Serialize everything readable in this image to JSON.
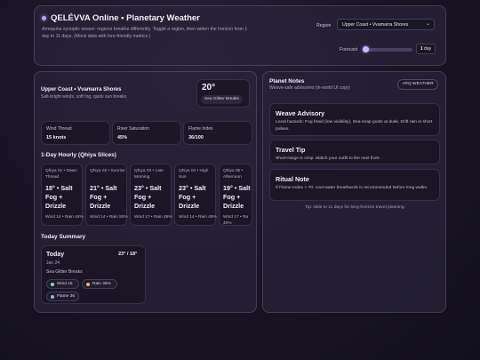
{
  "header": {
    "title": "QELÉVVA Online • Planetary Weather",
    "subtitle": "Arrequina synoptic weave: regions breathe differently. Toggle a region, then widen the horizon from 1 day to 11 days. (Mock data with lore-friendly metrics.)",
    "region_label": "Region",
    "region_value": "Upper Coast • Vvamarra Shores",
    "forecast_label": "Forecast",
    "forecast_days": "1",
    "forecast_unit": "day",
    "forecast_slider_fraction": 0.0
  },
  "location": {
    "name": "Upper Coast • Vvamarra Shores",
    "desc": "Salt-bright winds, soft fog, quick sun breaks",
    "temp": "20°",
    "condition": "Sea Glitter Breaks"
  },
  "metrics": [
    {
      "label": "Wind Thread",
      "value": "15 knots"
    },
    {
      "label": "River Saturation",
      "value": "45%"
    },
    {
      "label": "Flame Index",
      "value": "36/100"
    }
  ],
  "hourly": {
    "title": "1-Day Hourly (Qhiya Slices)",
    "slices": [
      {
        "head": "Qhiya 01 • Dawn Thread",
        "temp": "18° • Salt Fog + Drizzle",
        "meta": "Wind 14 • Rain 44%"
      },
      {
        "head": "Qhiya 02 • Sunrise",
        "temp": "21° • Salt Fog + Drizzle",
        "meta": "Wind 14 • Rain 50%"
      },
      {
        "head": "Qhiya 03 • Late Morning",
        "temp": "23° • Salt Fog + Drizzle",
        "meta": "Wind 17 • Rain 45%"
      },
      {
        "head": "Qhiya 04 • High Sun",
        "temp": "23° • Salt Fog + Drizzle",
        "meta": "Wind 14 • Rain 49%"
      },
      {
        "head": "Qhiya 05 • Afternoon",
        "temp": "19° • Salt Fog + Drizzle",
        "meta": "Wind 17 • Ra 40%"
      }
    ]
  },
  "summary": {
    "title": "Today Summary",
    "day": "Today",
    "date": "Jan 24",
    "hilo": "23° / 18°",
    "condition": "Sea Glitter Breaks",
    "chips": [
      {
        "label": "Wind 15",
        "color": "#7be0a8"
      },
      {
        "label": "Rain 45%",
        "color": "#f0b86a"
      },
      {
        "label": "Flame 36",
        "color": "#8fb5ff"
      }
    ]
  },
  "notes": {
    "title": "Planet Notes",
    "subtitle": "Weave-safe advisories (in-world UI copy)",
    "button": "ARQ WEATHER",
    "cards": [
      {
        "title": "Weave Advisory",
        "text": "Local hazards: Fog braid (low visibility), Sea-snap gusts at dusk, Drift rain in short pulses."
      },
      {
        "title": "Travel Tip",
        "text": "Short-range is crisp. Match your outfit to the next front."
      },
      {
        "title": "Ritual Note",
        "text": "If Flame Index > 70: cool-water breathwork is recommended before long walks."
      }
    ],
    "tip": "Tip: slide to 11 days for long-horizon travel planning."
  }
}
